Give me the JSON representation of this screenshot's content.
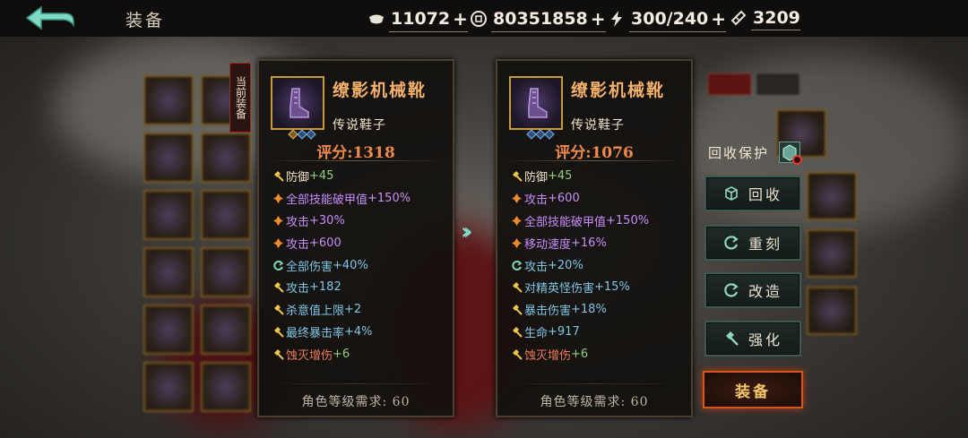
{
  "header": {
    "back_icon": "back-arrow-icon",
    "title": "装备",
    "resources": [
      {
        "name": "silver",
        "icon": "silver-ingot-icon",
        "value": "11072"
      },
      {
        "name": "coin",
        "icon": "coin-icon",
        "value": "80351858"
      },
      {
        "name": "stamina",
        "icon": "lightning-icon",
        "value": "300/240"
      },
      {
        "name": "ticket",
        "icon": "ticket-icon",
        "value": "3209"
      }
    ]
  },
  "current_tag": "当前装备",
  "compare": [
    {
      "name": "缭影机械靴",
      "type": "传说鞋子",
      "score": "评分:1318",
      "stats": [
        {
          "icon": "shield-icon",
          "label": "防御",
          "value": "+45",
          "label_color": "#f1e4c8",
          "value_color": "#8fd07a"
        },
        {
          "icon": "flame-icon",
          "label": "全部技能破甲值",
          "value": "+150%",
          "label_color": "#c78dfa",
          "value_color": "#c78dfa"
        },
        {
          "icon": "flame-icon",
          "label": "攻击",
          "value": "+30%",
          "label_color": "#c78dfa",
          "value_color": "#c78dfa"
        },
        {
          "icon": "flame-icon",
          "label": "攻击",
          "value": "+600",
          "label_color": "#c78dfa",
          "value_color": "#c78dfa"
        },
        {
          "icon": "swirl-icon",
          "label": "全部伤害",
          "value": "+40%",
          "label_color": "#7fc6e6",
          "value_color": "#7fc6e6"
        },
        {
          "icon": "hammer-icon",
          "label": "攻击",
          "value": "+182",
          "label_color": "#7fc6e6",
          "value_color": "#7fc6e6"
        },
        {
          "icon": "hammer-icon",
          "label": "杀意值上限",
          "value": "+2",
          "label_color": "#7fc6e6",
          "value_color": "#7fc6e6"
        },
        {
          "icon": "hammer-icon",
          "label": "最终暴击率",
          "value": "+4%",
          "label_color": "#7fc6e6",
          "value_color": "#7fc6e6"
        },
        {
          "icon": "hammer-icon",
          "label": "蚀灭增伤",
          "value": "+6",
          "label_color": "#f07a5a",
          "value_color": "#8fd07a"
        }
      ],
      "requirement": "角色等级需求: 60"
    },
    {
      "name": "缭影机械靴",
      "type": "传说鞋子",
      "score": "评分:1076",
      "stats": [
        {
          "icon": "shield-icon",
          "label": "防御",
          "value": "+45",
          "label_color": "#f1e4c8",
          "value_color": "#8fd07a"
        },
        {
          "icon": "flame-icon",
          "label": "攻击",
          "value": "+600",
          "label_color": "#c78dfa",
          "value_color": "#c78dfa"
        },
        {
          "icon": "flame-icon",
          "label": "全部技能破甲值",
          "value": "+150%",
          "label_color": "#c78dfa",
          "value_color": "#c78dfa"
        },
        {
          "icon": "flame-icon",
          "label": "移动速度",
          "value": "+16%",
          "label_color": "#c78dfa",
          "value_color": "#c78dfa"
        },
        {
          "icon": "swirl-icon",
          "label": "攻击",
          "value": "+20%",
          "label_color": "#7fc6e6",
          "value_color": "#7fc6e6"
        },
        {
          "icon": "hammer-icon",
          "label": "对精英怪伤害",
          "value": "+15%",
          "label_color": "#7fc6e6",
          "value_color": "#7fc6e6"
        },
        {
          "icon": "hammer-icon",
          "label": "暴击伤害",
          "value": "+18%",
          "label_color": "#7fc6e6",
          "value_color": "#7fc6e6"
        },
        {
          "icon": "hammer-icon",
          "label": "生命",
          "value": "+917",
          "label_color": "#7fc6e6",
          "value_color": "#7fc6e6"
        },
        {
          "icon": "hammer-icon",
          "label": "蚀灭增伤",
          "value": "+6",
          "label_color": "#f07a5a",
          "value_color": "#8fd07a"
        }
      ],
      "requirement": "角色等级需求: 60"
    }
  ],
  "actions": {
    "recycle_protect_label": "回收保护",
    "buttons": [
      {
        "label": "回收",
        "icon": "cube-icon"
      },
      {
        "label": "重刻",
        "icon": "refresh-icon"
      },
      {
        "label": "改造",
        "icon": "refresh-icon"
      },
      {
        "label": "强化",
        "icon": "hammer-icon"
      }
    ],
    "equip_label": "装备"
  }
}
